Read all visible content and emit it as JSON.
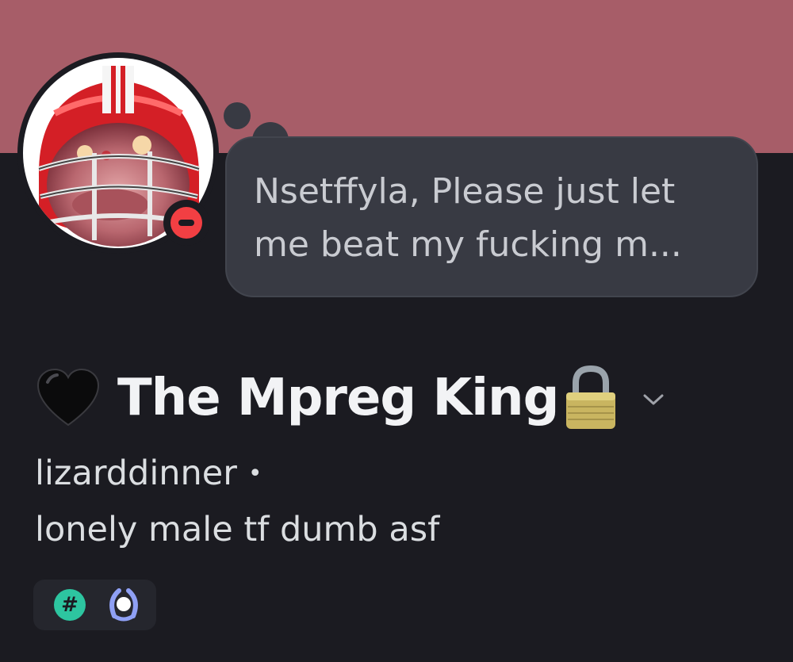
{
  "profile": {
    "status_note": "Nsetffyla, Please just let me beat my fucking m...",
    "display_name": "The Mpreg King",
    "username": "lizarddinner",
    "separator": "•",
    "pronouns": "lonely male tf dumb asf",
    "status": "do-not-disturb"
  },
  "badges": [
    {
      "icon": "hashtag-badge-icon",
      "glyph": "#"
    },
    {
      "icon": "laurel-badge-icon"
    }
  ],
  "colors": {
    "banner": "#a75d68",
    "background": "#1b1b21",
    "bubble": "#383a43",
    "dnd_status": "#f23f43",
    "hashtag_badge": "#2dc5a0",
    "laurel_badge": "#8fa0f5"
  }
}
